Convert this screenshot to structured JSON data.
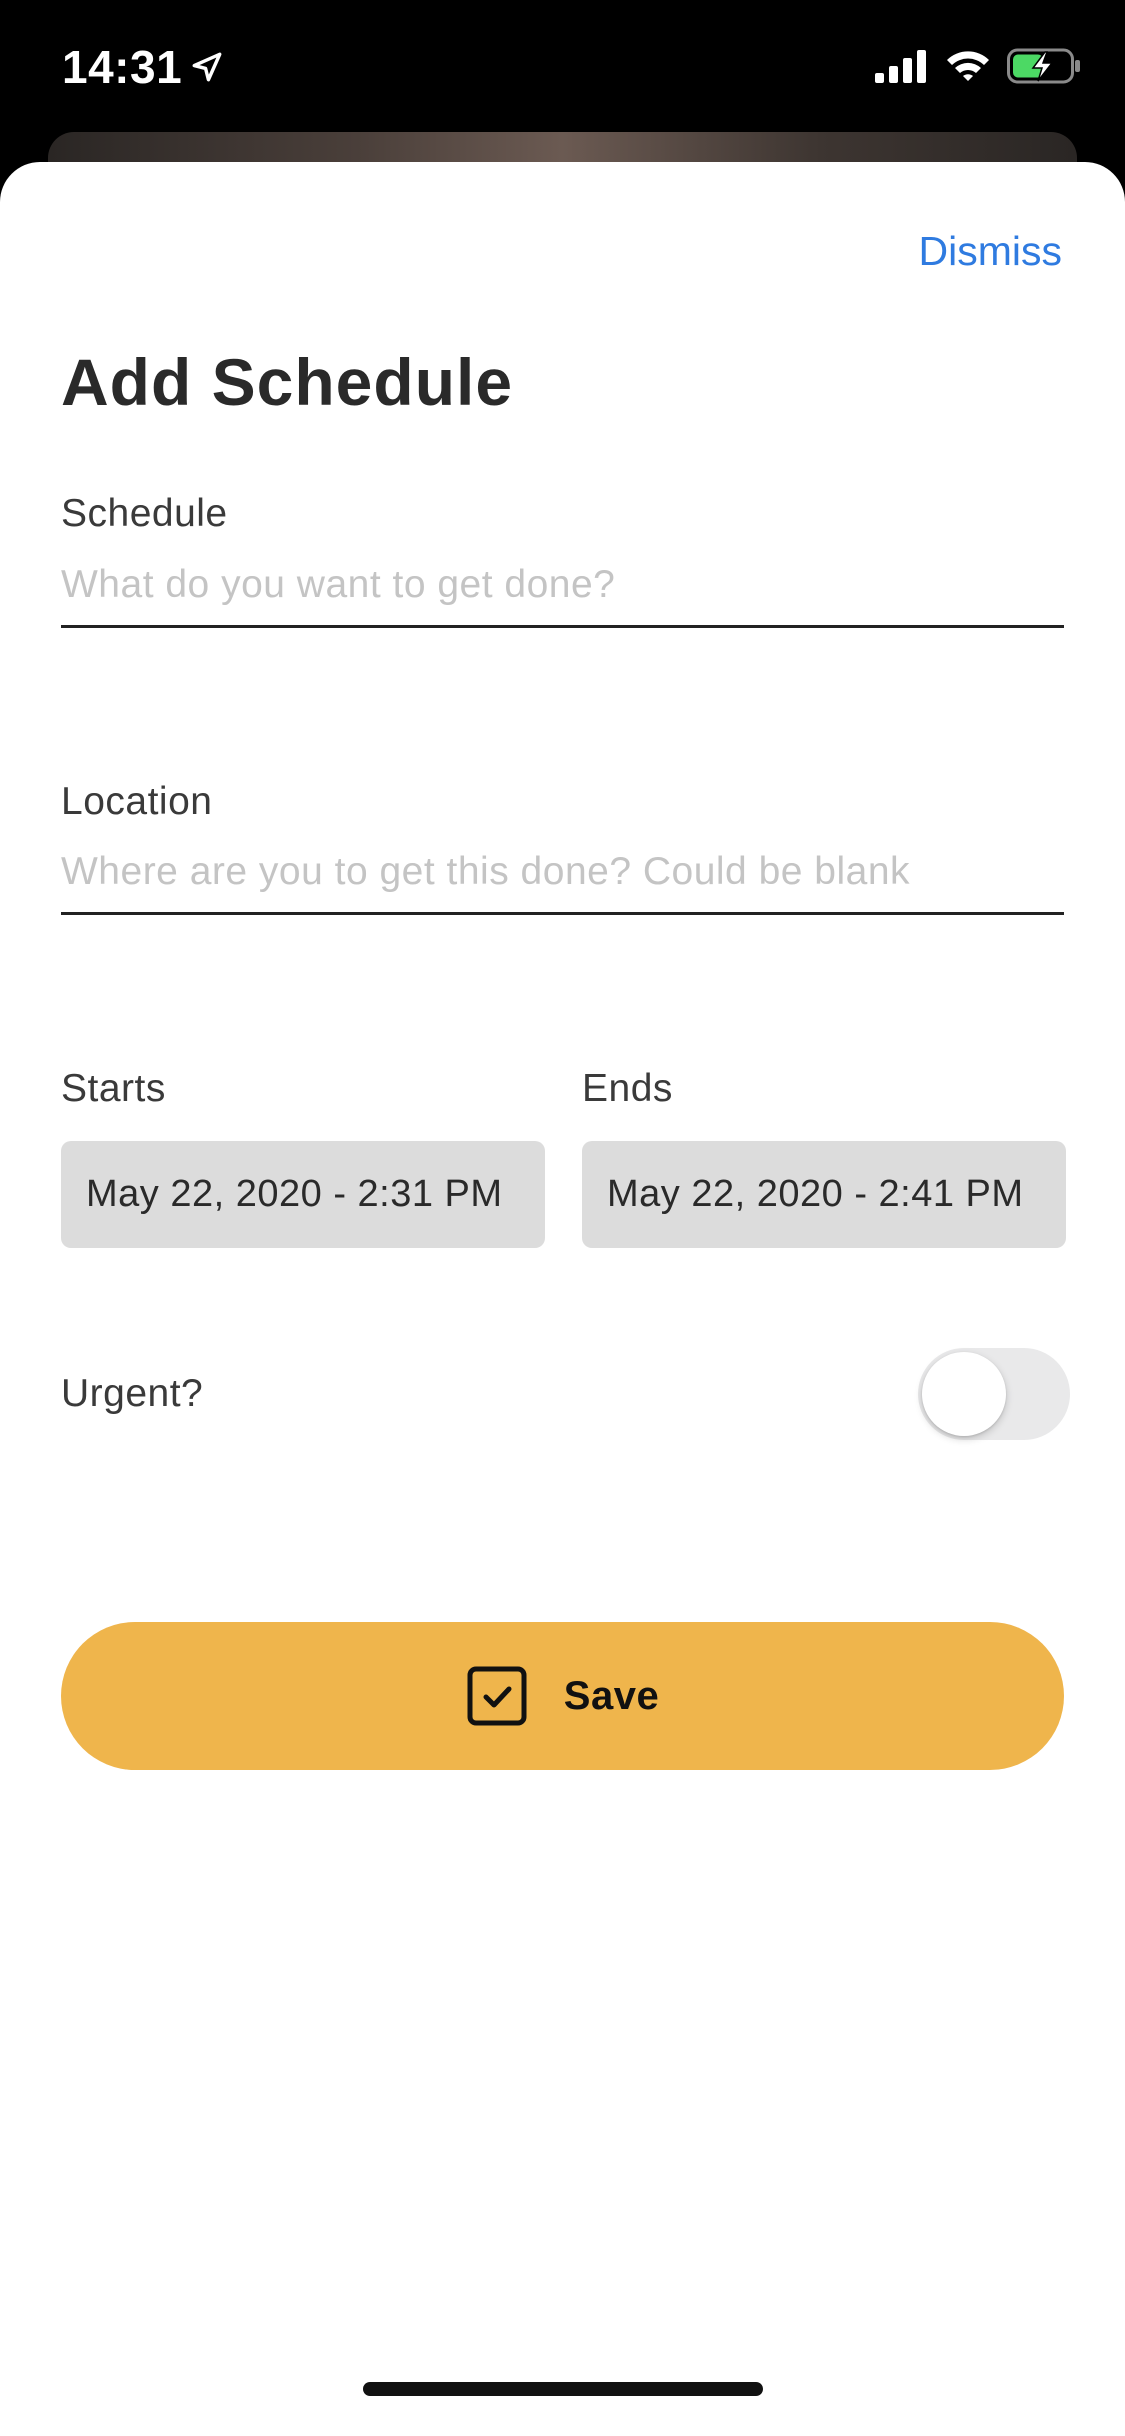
{
  "status_bar": {
    "time": "14:31",
    "icons": [
      "location-arrow-icon",
      "cellular-signal-icon",
      "wifi-icon",
      "battery-charging-icon"
    ]
  },
  "sheet": {
    "dismiss_label": "Dismiss",
    "title": "Add Schedule",
    "schedule": {
      "label": "Schedule",
      "placeholder": "What do you want to get done?",
      "value": ""
    },
    "location": {
      "label": "Location",
      "placeholder": "Where are you to get this done? Could be blank",
      "value": ""
    },
    "starts": {
      "label": "Starts",
      "value": "May 22, 2020 - 2:31 PM"
    },
    "ends": {
      "label": "Ends",
      "value": "May 22, 2020 - 2:41 PM"
    },
    "urgent": {
      "label": "Urgent?",
      "on": false
    },
    "save": {
      "label": "Save",
      "icon": "checkbox-check-icon"
    }
  },
  "colors": {
    "accent_link": "#2f7be0",
    "save_button": "#efb54c",
    "date_box": "#dcdcdc",
    "toggle_off_track": "#e9e9ea"
  }
}
